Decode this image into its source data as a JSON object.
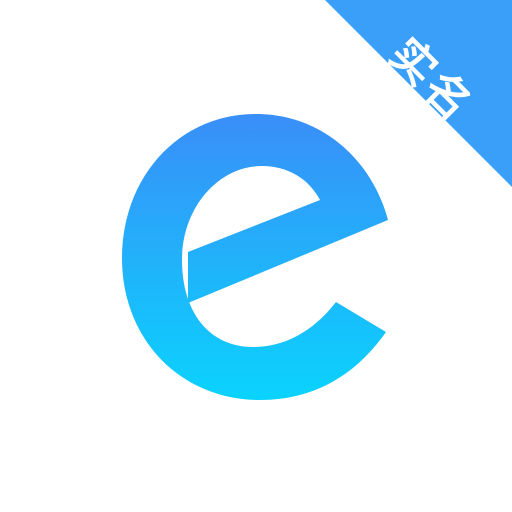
{
  "logo": {
    "icon": "letter-e-logo",
    "gradient_top": "#3a8ef8",
    "gradient_bottom": "#0ad3fd"
  },
  "badge": {
    "text": "实名",
    "background": "#3a9ff9",
    "text_color": "#ffffff"
  },
  "background": "#ffffff"
}
